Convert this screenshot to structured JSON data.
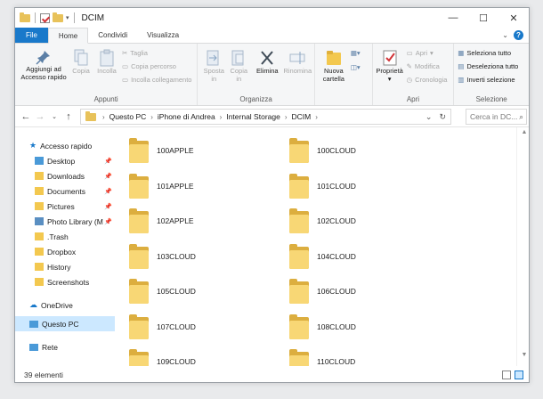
{
  "window": {
    "title": "DCIM",
    "controls": {
      "minimize": "—",
      "maximize": "☐",
      "close": "✕"
    }
  },
  "ribbon_tabs": [
    {
      "label": "File"
    },
    {
      "label": "Home"
    },
    {
      "label": "Condividi"
    },
    {
      "label": "Visualizza"
    }
  ],
  "ribbon": {
    "appunti": {
      "label": "Appunti",
      "pin_label_1": "Aggiungi ad",
      "pin_label_2": "Accesso rapido",
      "copy": "Copia",
      "paste": "Incolla",
      "cut": "Taglia",
      "copy_path": "Copia percorso",
      "paste_link": "Incolla collegamento"
    },
    "organizza": {
      "label": "Organizza",
      "move_1": "Sposta",
      "move_2": "in",
      "copy_1": "Copia",
      "copy_2": "in",
      "delete": "Elimina",
      "rename": "Rinomina"
    },
    "nuovo": {
      "new_folder_1": "Nuova",
      "new_folder_2": "cartella"
    },
    "apri": {
      "label": "Apri",
      "properties": "Proprietà",
      "open": "Apri",
      "edit": "Modifica",
      "history": "Cronologia"
    },
    "selezione": {
      "label": "Selezione",
      "select_all": "Seleziona tutto",
      "select_none": "Deseleziona tutto",
      "invert": "Inverti selezione"
    }
  },
  "address": {
    "breadcrumb": [
      "Questo PC",
      "iPhone di Andrea",
      "Internal Storage",
      "DCIM"
    ],
    "search_placeholder": "Cerca in DC..."
  },
  "sidebar": {
    "quick_access": "Accesso rapido",
    "items": [
      {
        "label": "Desktop",
        "pinned": true
      },
      {
        "label": "Downloads",
        "pinned": true
      },
      {
        "label": "Documents",
        "pinned": true
      },
      {
        "label": "Pictures",
        "pinned": true
      },
      {
        "label": "Photo Library (M",
        "pinned": true
      },
      {
        "label": ".Trash",
        "pinned": false
      },
      {
        "label": "Dropbox",
        "pinned": false
      },
      {
        "label": "History",
        "pinned": false
      },
      {
        "label": "Screenshots",
        "pinned": false
      }
    ],
    "onedrive": "OneDrive",
    "this_pc": "Questo PC",
    "network": "Rete"
  },
  "folders_col1": [
    "100APPLE",
    "101APPLE",
    "102APPLE",
    "103CLOUD",
    "105CLOUD",
    "107CLOUD",
    "109CLOUD"
  ],
  "folders_col2": [
    "100CLOUD",
    "101CLOUD",
    "102CLOUD",
    "104CLOUD",
    "106CLOUD",
    "108CLOUD",
    "110CLOUD"
  ],
  "status": {
    "count": "39 elementi"
  },
  "colors": {
    "accent": "#1979ca",
    "folder": "#f8d775",
    "selection": "#cce8ff"
  }
}
